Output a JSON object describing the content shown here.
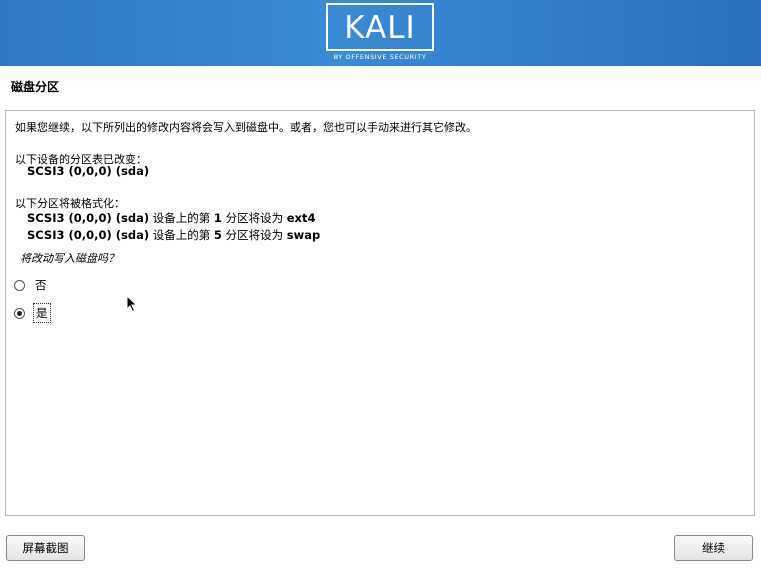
{
  "header": {
    "logo_text": "KALI",
    "logo_tagline": "BY OFFENSIVE SECURITY"
  },
  "page": {
    "title": "磁盘分区"
  },
  "content": {
    "intro": "如果您继续，以下所列出的修改内容将会写入到磁盘中。或者，您也可以手动来进行其它修改。",
    "partition_table_label": "以下设备的分区表已改变：",
    "partition_table_device": "SCSI3 (0,0,0) (sda)",
    "format_label": "以下分区将被格式化：",
    "format_items": [
      {
        "device": "SCSI3 (0,0,0) (sda)",
        "text_a": " 设备上的第 ",
        "num": "1",
        "text_b": " 分区将设为 ",
        "fs": "ext4"
      },
      {
        "device": "SCSI3 (0,0,0) (sda)",
        "text_a": " 设备上的第 ",
        "num": "5",
        "text_b": " 分区将设为 ",
        "fs": "swap"
      }
    ],
    "question": "将改动写入磁盘吗？",
    "options": [
      {
        "label": "否",
        "selected": false
      },
      {
        "label": "是",
        "selected": true
      }
    ]
  },
  "buttons": {
    "screenshot": "屏幕截图",
    "continue": "继续"
  },
  "colors": {
    "header_blue": "#2f78c6",
    "panel_border": "#b9b9b9"
  }
}
